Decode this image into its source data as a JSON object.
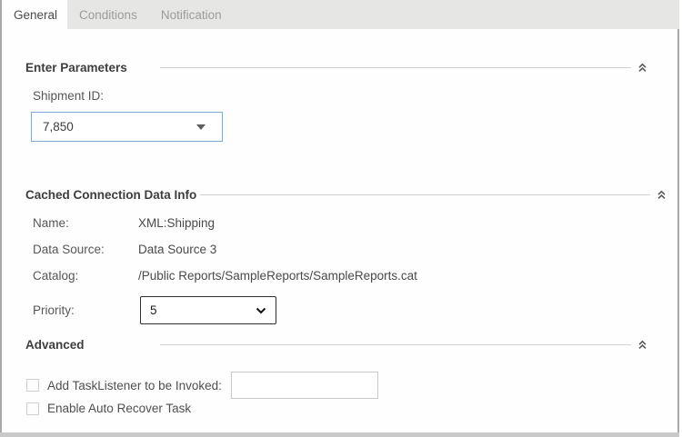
{
  "tabs": {
    "items": [
      {
        "label": "General",
        "active": true
      },
      {
        "label": "Conditions",
        "active": false
      },
      {
        "label": "Notification",
        "active": false
      }
    ]
  },
  "parameters_section": {
    "title": "Enter Parameters",
    "shipment_id_label": "Shipment ID:",
    "shipment_id_value": "7,850"
  },
  "cached_section": {
    "title": "Cached Connection Data Info",
    "rows": [
      {
        "label": "Name:",
        "value": "XML:Shipping"
      },
      {
        "label": "Data Source:",
        "value": "Data Source 3"
      },
      {
        "label": "Catalog:",
        "value": "/Public Reports/SampleReports/SampleReports.cat"
      }
    ],
    "priority_label": "Priority:",
    "priority_value": "5"
  },
  "advanced_section": {
    "title": "Advanced",
    "tasklistener_label": "Add TaskListener to be Invoked:",
    "tasklistener_value": "",
    "autorecover_label": "Enable Auto Recover Task",
    "tasklistener_checked": false,
    "autorecover_checked": false
  },
  "icons": {
    "collapse": "double-chevron-up",
    "combo_arrow": "triangle-down",
    "select_arrow": "chevron-down"
  },
  "colors": {
    "tab_bar_bg": "#e6e6e4",
    "active_tab_text": "#4a4a4a",
    "inactive_tab_text": "#9c9c9c",
    "heading_text": "#3e3e3e",
    "label_text": "#575757",
    "value_text": "#4a4a4a",
    "section_rule": "#d2d2d2",
    "combo_border": "#83a8d2",
    "select_border": "#2f2f2f",
    "input_border": "#c9c9c9",
    "frame_border": "#aba9a6",
    "bottom_bar": "#c9c9c9"
  }
}
